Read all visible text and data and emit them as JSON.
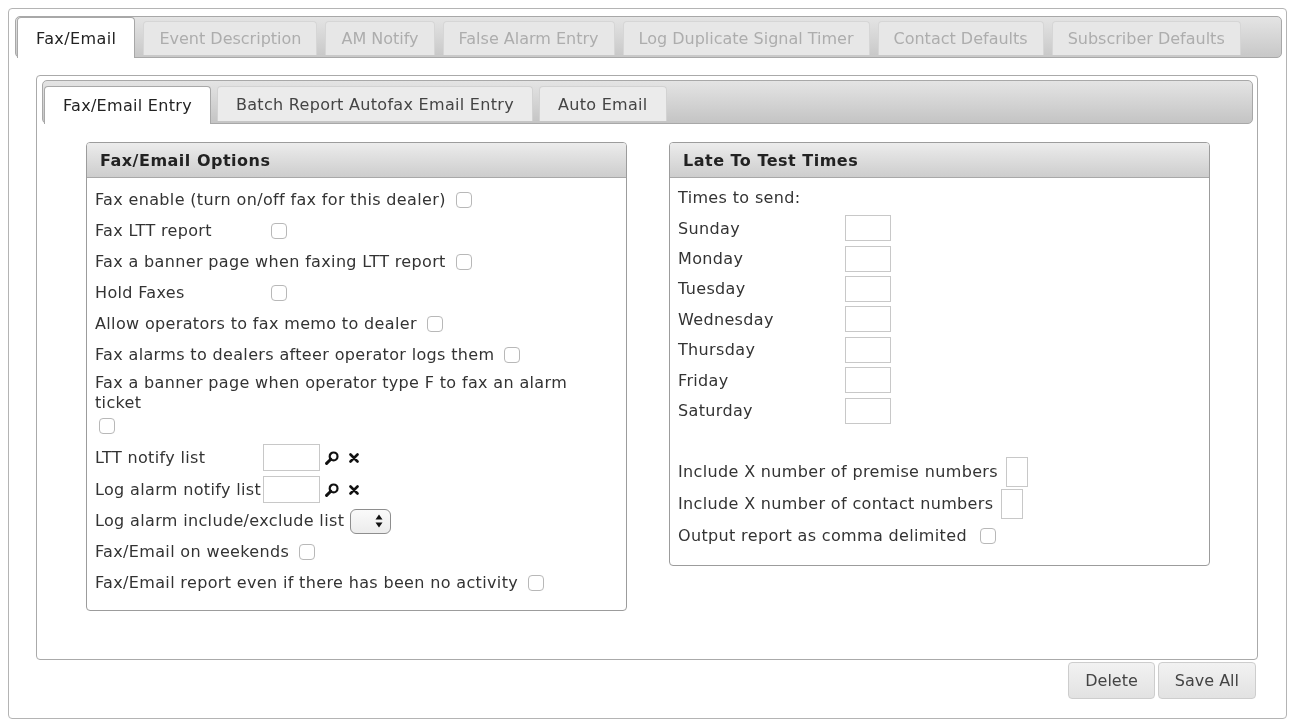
{
  "tabs": [
    {
      "label": "Fax/Email",
      "selected": true
    },
    {
      "label": "Event Description",
      "selected": false
    },
    {
      "label": "AM Notify",
      "selected": false
    },
    {
      "label": "False Alarm Entry",
      "selected": false
    },
    {
      "label": "Log Duplicate Signal Timer",
      "selected": false
    },
    {
      "label": "Contact Defaults",
      "selected": false
    },
    {
      "label": "Subscriber Defaults",
      "selected": false
    }
  ],
  "subtabs": [
    {
      "label": "Fax/Email Entry",
      "selected": true
    },
    {
      "label": "Batch Report Autofax Email Entry",
      "selected": false
    },
    {
      "label": "Auto Email",
      "selected": false
    }
  ],
  "options_panel": {
    "title": "Fax/Email Options",
    "rows": [
      {
        "kind": "checkbox",
        "label": "Fax enable (turn on/off fax for this dealer)",
        "checked": false
      },
      {
        "kind": "checkbox",
        "label": "Fax LTT report",
        "checked": false
      },
      {
        "kind": "checkbox",
        "label": "Fax a banner page when faxing LTT report",
        "checked": false
      },
      {
        "kind": "checkbox",
        "label": "Hold Faxes",
        "checked": false
      },
      {
        "kind": "checkbox",
        "label": "Allow operators to fax memo to dealer",
        "checked": false
      },
      {
        "kind": "checkbox",
        "label": "Fax alarms to dealers afteer operator logs them",
        "checked": false
      },
      {
        "kind": "checkbox_below",
        "label": "Fax a banner page when operator type F to fax an alarm ticket",
        "checked": false
      },
      {
        "kind": "lookup",
        "label": "LTT notify list"
      },
      {
        "kind": "lookup",
        "label": "Log alarm notify list"
      },
      {
        "kind": "select",
        "label": "Log alarm include/exclude list"
      },
      {
        "kind": "checkbox",
        "label": "Fax/Email on weekends",
        "checked": false
      },
      {
        "kind": "checkbox",
        "label": "Fax/Email report even if there has been no activity",
        "checked": false
      }
    ]
  },
  "late_panel": {
    "title": "Late To Test Times",
    "intro": "Times to send:",
    "days": [
      "Sunday",
      "Monday",
      "Tuesday",
      "Wednesday",
      "Thursday",
      "Friday",
      "Saturday"
    ],
    "options": [
      {
        "kind": "number",
        "label": "Include X number of premise numbers"
      },
      {
        "kind": "number",
        "label": "Include X number of contact numbers"
      },
      {
        "kind": "checkbox",
        "label": "Output report as comma delimited",
        "checked": false
      }
    ]
  },
  "buttons": [
    "Delete",
    "Save All"
  ]
}
